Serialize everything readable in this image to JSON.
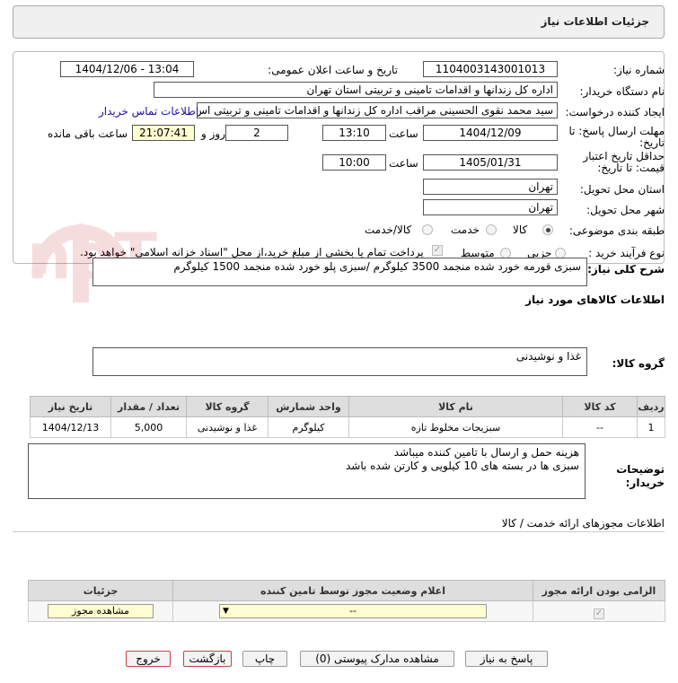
{
  "header": {
    "title": "جزئیات اطلاعات نیاز"
  },
  "fields": {
    "need_number_label": "شماره نیاز:",
    "need_number": "1104003143001013",
    "announce_label": "تاریخ و ساعت اعلان عمومی:",
    "announce_value": "1404/12/06 - 13:04",
    "buyer_label": "نام دستگاه خریدار:",
    "buyer_value": "اداره کل زندانها و اقدامات تامینی و تربیتی استان تهران",
    "creator_label": "ایجاد کننده درخواست:",
    "creator_value": "سید محمد نقوی الحسینی مراقب  اداره کل زندانها و اقدامات تامینی و تربیتی اس",
    "contact_link": "اطلاعات تماس خریدار",
    "deadline_label_1": "مهلت ارسال پاسخ: تا",
    "deadline_label_2": "تاریخ:",
    "deadline_date": "1404/12/09",
    "time_label": "ساعت",
    "deadline_time": "13:10",
    "days_value": "2",
    "days_label": "روز و",
    "remaining_time": "21:07:41",
    "remaining_label": "ساعت باقی مانده",
    "validity_label_1": "حداقل تاریخ اعتبار",
    "validity_label_2": "قیمت: تا تاریخ:",
    "validity_date": "1405/01/31",
    "validity_time": "10:00",
    "province_label": "استان محل تحویل:",
    "province_value": "تهران",
    "city_label": "شهر محل تحویل:",
    "city_value": "تهران",
    "category_label": "طبقه بندی موضوعی:",
    "category_options": [
      "کالا",
      "خدمت",
      "کالا/خدمت"
    ],
    "process_label": "نوع فرآیند خرید :",
    "process_options": [
      "جزیی",
      "متوسط"
    ],
    "payment_note": "پرداخت تمام یا بخشی از مبلغ خرید،از محل \"اسناد خزانه اسلامی\" خواهد بود."
  },
  "summary": {
    "label": "شرح کلی نیاز:",
    "value": "سبزی قورمه خورد شده منجمد 3500 کیلوگرم /سبزی پلو خورد شده منجمد 1500 کیلوگرم"
  },
  "goods_info": {
    "title": "اطلاعات کالاهای مورد نیاز",
    "group_label": "گروه کالا:",
    "group_value": "غذا و نوشیدنی",
    "table": {
      "headers": [
        "ردیف",
        "کد کالا",
        "نام کالا",
        "واحد شمارش",
        "گروه کالا",
        "تعداد / مقدار",
        "تاریخ نیاز"
      ],
      "rows": [
        [
          "1",
          "--",
          "سبزیجات مخلوط تازه",
          "کیلوگرم",
          "غذا و نوشیدنی",
          "5,000",
          "1404/12/13"
        ]
      ]
    },
    "notes_label_1": "توضیحات",
    "notes_label_2": "خریدار:",
    "notes_line1": "هزینه حمل و ارسال با تامین کننده میباشد",
    "notes_line2": "سبزی ها در بسته های 10 کیلویی و  کارتن شده باشد"
  },
  "permits": {
    "title": "اطلاعات مجوزهای ارائه خدمت / کالا",
    "headers": [
      "الزامی بودن ارائه مجوز",
      "اعلام وضعیت مجوز توسط تامین کننده",
      "جزئیات"
    ],
    "select_value": "--",
    "view_button": "مشاهده مجوز"
  },
  "buttons": {
    "reply": "پاسخ به نیاز",
    "docs": "مشاهده مدارک پیوستی (0)",
    "print": "چاپ",
    "back": "بازگشت",
    "exit": "خروج"
  },
  "watermark": {
    "brand_text": "AriaTender.neT"
  },
  "colors": {
    "link": "#1a0dab",
    "highlight": "#fefed0",
    "exit_border": "#d04040"
  }
}
